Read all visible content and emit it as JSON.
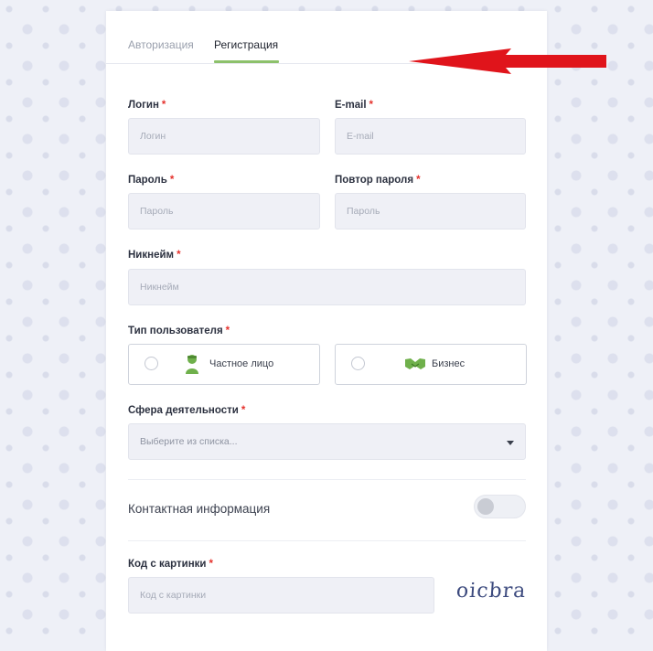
{
  "tabs": {
    "login": "Авторизация",
    "register": "Регистрация"
  },
  "fields": {
    "login": {
      "label": "Логин",
      "placeholder": "Логин"
    },
    "email": {
      "label": "E-mail",
      "placeholder": "E-mail"
    },
    "password": {
      "label": "Пароль",
      "placeholder": "Пароль"
    },
    "password_repeat": {
      "label": "Повтор пароля",
      "placeholder": "Пароль"
    },
    "nickname": {
      "label": "Никнейм",
      "placeholder": "Никнейм"
    },
    "captcha": {
      "label": "Код с картинки",
      "placeholder": "Код с картинки"
    }
  },
  "required_mark": "*",
  "user_type": {
    "label": "Тип пользователя",
    "options": [
      "Частное лицо",
      "Бизнес"
    ]
  },
  "activity": {
    "label": "Сфера деятельности",
    "placeholder": "Выберите из списка..."
  },
  "contact_info": {
    "title": "Контактная информация",
    "enabled": false
  },
  "captcha_image_text": "oicbra",
  "colors": {
    "accent_green": "#8dc16b",
    "required_red": "#e5322d",
    "arrow_red": "#e0141b",
    "captcha_blue": "#3c4a7e"
  },
  "icons": {
    "private_person": "person-icon",
    "business": "handshake-icon",
    "select_caret": "caret-down-icon"
  }
}
